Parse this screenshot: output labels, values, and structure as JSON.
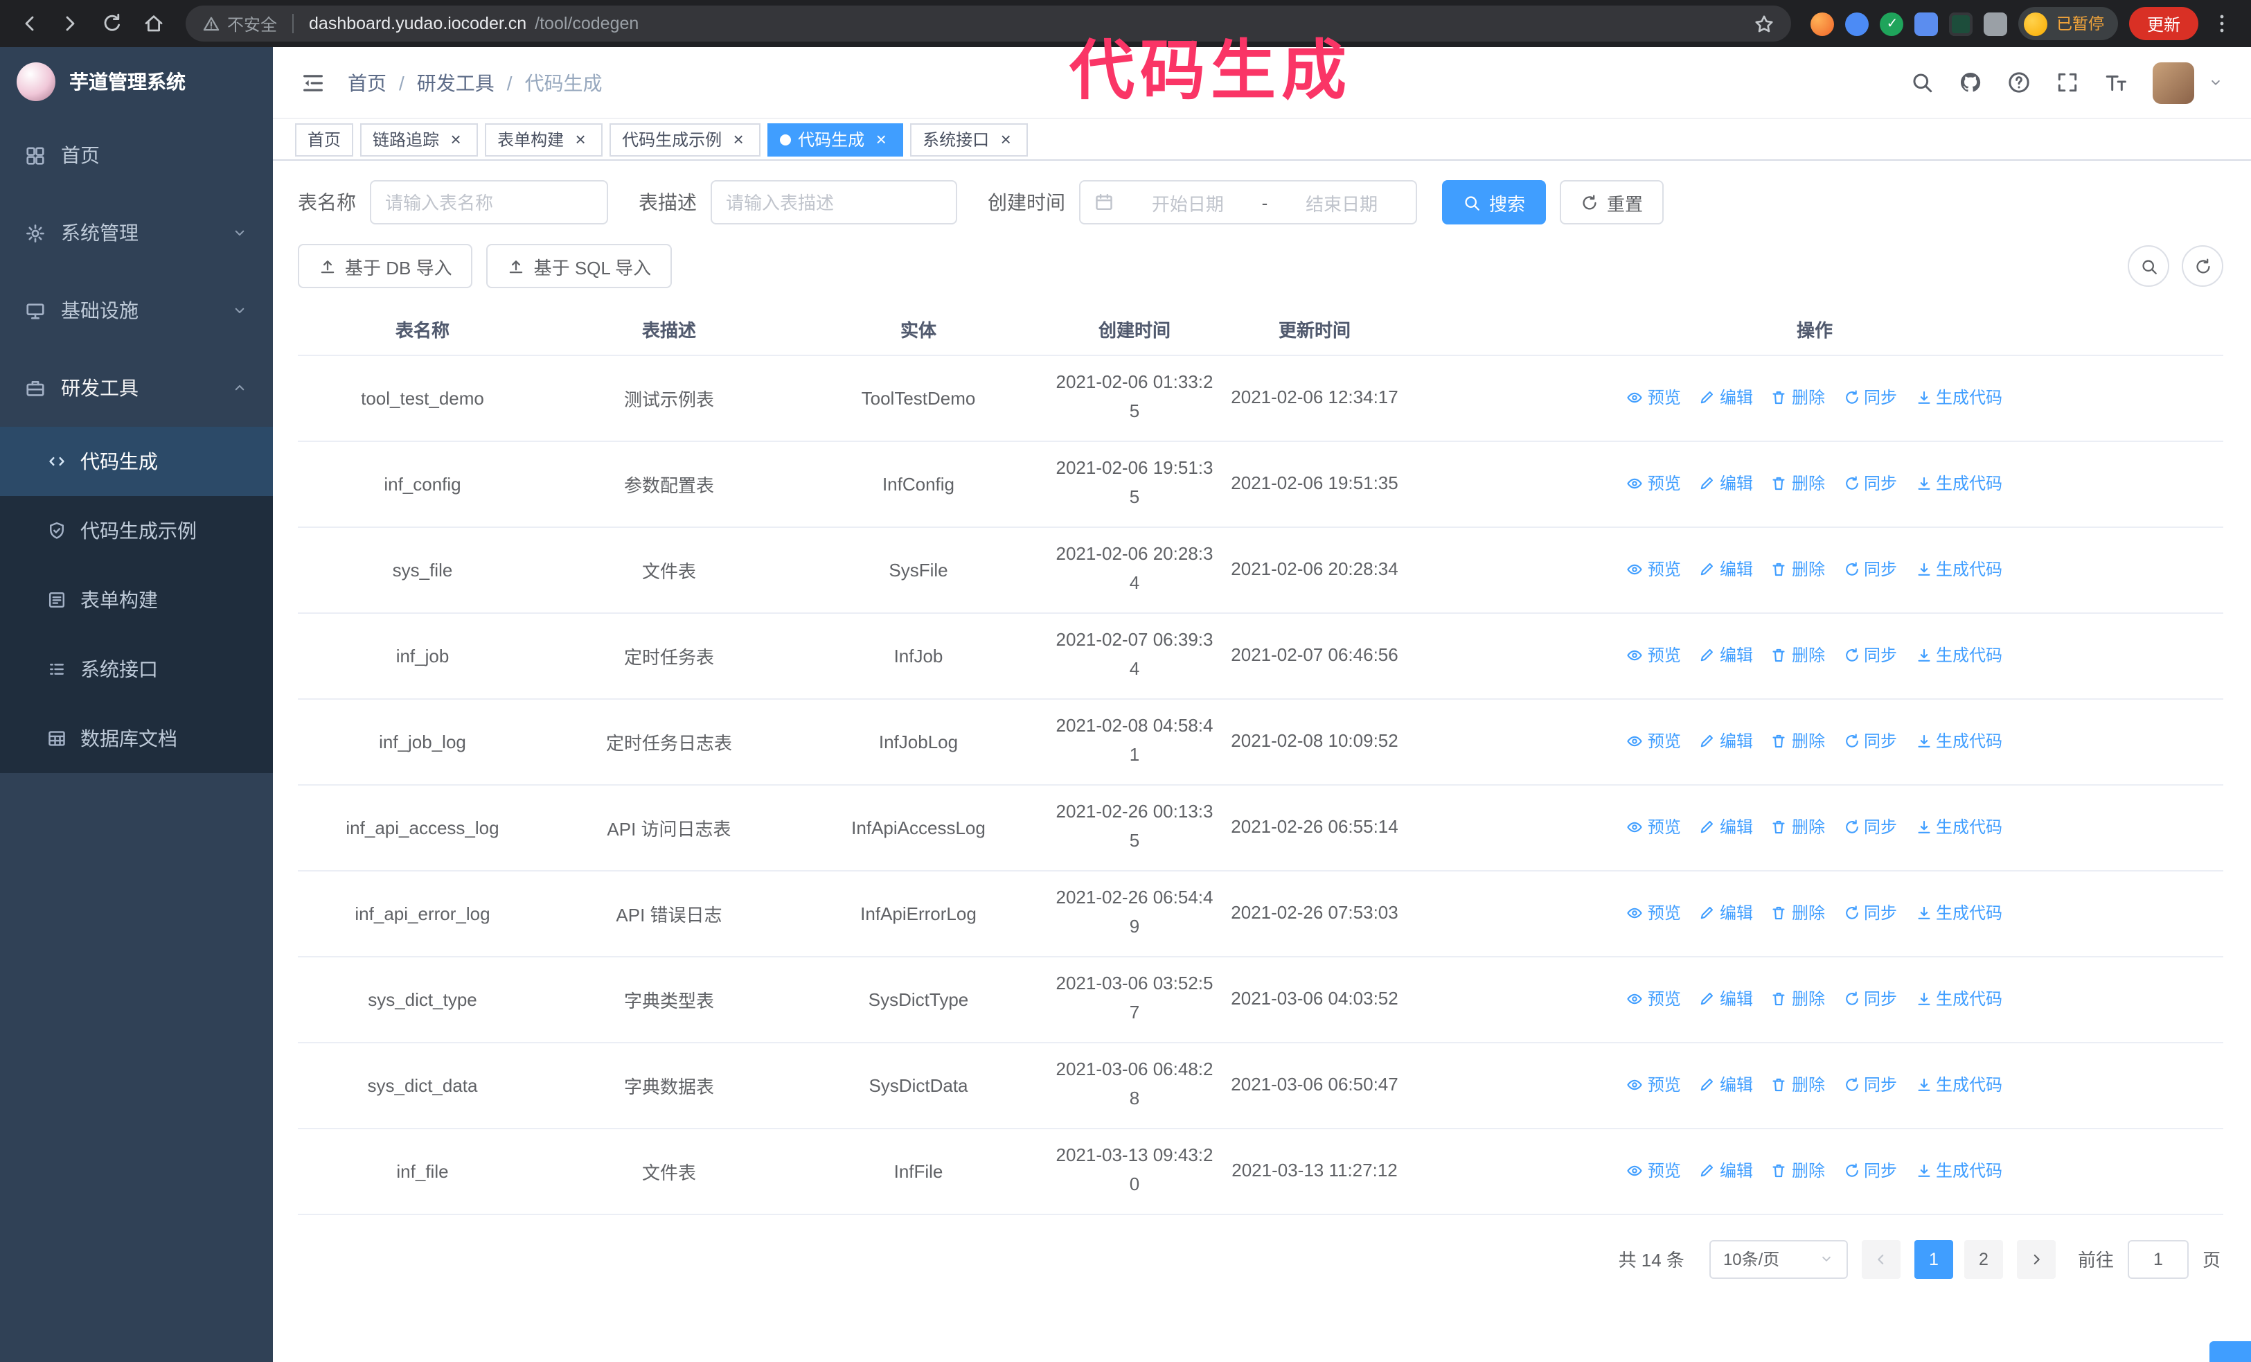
{
  "colors": {
    "accent": "#409eff",
    "sidebar_bg": "#304156",
    "submenu_bg": "#1f2d3d",
    "active_menu_bg": "#2c4a68",
    "annotation": "#fa3566",
    "update_button_bg": "#d93025",
    "tag_active_bg": "#409eff"
  },
  "browser": {
    "security_label": "不安全",
    "url_host": "dashboard.yudao.iocoder.cn",
    "url_path": "/tool/codegen",
    "profile_status": "已暂停",
    "update_label": "更新"
  },
  "annotation": "代码生成",
  "sidebar": {
    "logo_title": "芋道管理系统",
    "items": [
      {
        "id": "home",
        "label": "首页",
        "icon": "dashboard-icon"
      },
      {
        "id": "system",
        "label": "系统管理",
        "icon": "gear-icon",
        "chevron": "down"
      },
      {
        "id": "infra",
        "label": "基础设施",
        "icon": "infra-icon",
        "chevron": "down"
      },
      {
        "id": "devtools",
        "label": "研发工具",
        "icon": "toolbox-icon",
        "chevron": "up",
        "expanded": true,
        "children": [
          {
            "id": "codegen",
            "label": "代码生成",
            "icon": "code-icon",
            "active": true
          },
          {
            "id": "codegen-example",
            "label": "代码生成示例",
            "icon": "example-icon"
          },
          {
            "id": "form-builder",
            "label": "表单构建",
            "icon": "form-icon"
          },
          {
            "id": "api-doc",
            "label": "系统接口",
            "icon": "api-icon"
          },
          {
            "id": "db-doc",
            "label": "数据库文档",
            "icon": "db-icon"
          }
        ]
      }
    ]
  },
  "header": {
    "breadcrumb": [
      "首页",
      "研发工具",
      "代码生成"
    ],
    "separator": "/"
  },
  "tags": [
    {
      "id": "home",
      "label": "首页",
      "closable": false,
      "active": false
    },
    {
      "id": "tracer",
      "label": "链路追踪",
      "closable": true,
      "active": false
    },
    {
      "id": "form-builder",
      "label": "表单构建",
      "closable": true,
      "active": false
    },
    {
      "id": "codegen-example",
      "label": "代码生成示例",
      "closable": true,
      "active": false
    },
    {
      "id": "codegen",
      "label": "代码生成",
      "closable": true,
      "active": true
    },
    {
      "id": "api-doc",
      "label": "系统接口",
      "closable": true,
      "active": false
    }
  ],
  "filters": {
    "table_name_label": "表名称",
    "table_name_placeholder": "请输入表名称",
    "table_desc_label": "表描述",
    "table_desc_placeholder": "请输入表描述",
    "create_time_label": "创建时间",
    "start_placeholder": "开始日期",
    "range_separator": "-",
    "end_placeholder": "结束日期",
    "search_label": "搜索",
    "reset_label": "重置"
  },
  "toolbar": {
    "import_db_label": "基于 DB 导入",
    "import_sql_label": "基于 SQL 导入"
  },
  "table": {
    "columns": [
      "表名称",
      "表描述",
      "实体",
      "创建时间",
      "更新时间",
      "操作"
    ],
    "actions": [
      {
        "id": "preview",
        "label": "预览",
        "icon": "eye-icon"
      },
      {
        "id": "edit",
        "label": "编辑",
        "icon": "edit-icon"
      },
      {
        "id": "delete",
        "label": "删除",
        "icon": "delete-icon"
      },
      {
        "id": "sync",
        "label": "同步",
        "icon": "sync-icon"
      },
      {
        "id": "generate",
        "label": "生成代码",
        "icon": "download-icon"
      }
    ],
    "rows": [
      {
        "name": "tool_test_demo",
        "desc": "测试示例表",
        "entity": "ToolTestDemo",
        "created": "2021-02-06 01:33:25",
        "updated": "2021-02-06 12:34:17"
      },
      {
        "name": "inf_config",
        "desc": "参数配置表",
        "entity": "InfConfig",
        "created": "2021-02-06 19:51:35",
        "updated": "2021-02-06 19:51:35"
      },
      {
        "name": "sys_file",
        "desc": "文件表",
        "entity": "SysFile",
        "created": "2021-02-06 20:28:34",
        "updated": "2021-02-06 20:28:34"
      },
      {
        "name": "inf_job",
        "desc": "定时任务表",
        "entity": "InfJob",
        "created": "2021-02-07 06:39:34",
        "updated": "2021-02-07 06:46:56"
      },
      {
        "name": "inf_job_log",
        "desc": "定时任务日志表",
        "entity": "InfJobLog",
        "created": "2021-02-08 04:58:41",
        "updated": "2021-02-08 10:09:52"
      },
      {
        "name": "inf_api_access_log",
        "desc": "API 访问日志表",
        "entity": "InfApiAccessLog",
        "created": "2021-02-26 00:13:35",
        "updated": "2021-02-26 06:55:14"
      },
      {
        "name": "inf_api_error_log",
        "desc": "API 错误日志",
        "entity": "InfApiErrorLog",
        "created": "2021-02-26 06:54:49",
        "updated": "2021-02-26 07:53:03"
      },
      {
        "name": "sys_dict_type",
        "desc": "字典类型表",
        "entity": "SysDictType",
        "created": "2021-03-06 03:52:57",
        "updated": "2021-03-06 04:03:52"
      },
      {
        "name": "sys_dict_data",
        "desc": "字典数据表",
        "entity": "SysDictData",
        "created": "2021-03-06 06:48:28",
        "updated": "2021-03-06 06:50:47"
      },
      {
        "name": "inf_file",
        "desc": "文件表",
        "entity": "InfFile",
        "created": "2021-03-13 09:43:20",
        "updated": "2021-03-13 11:27:12"
      }
    ]
  },
  "pagination": {
    "total_label": "共 14 条",
    "page_size_label": "10条/页",
    "pages": [
      "1",
      "2"
    ],
    "active_page": "1",
    "goto_label": "前往",
    "goto_value": "1",
    "unit_label": "页"
  }
}
